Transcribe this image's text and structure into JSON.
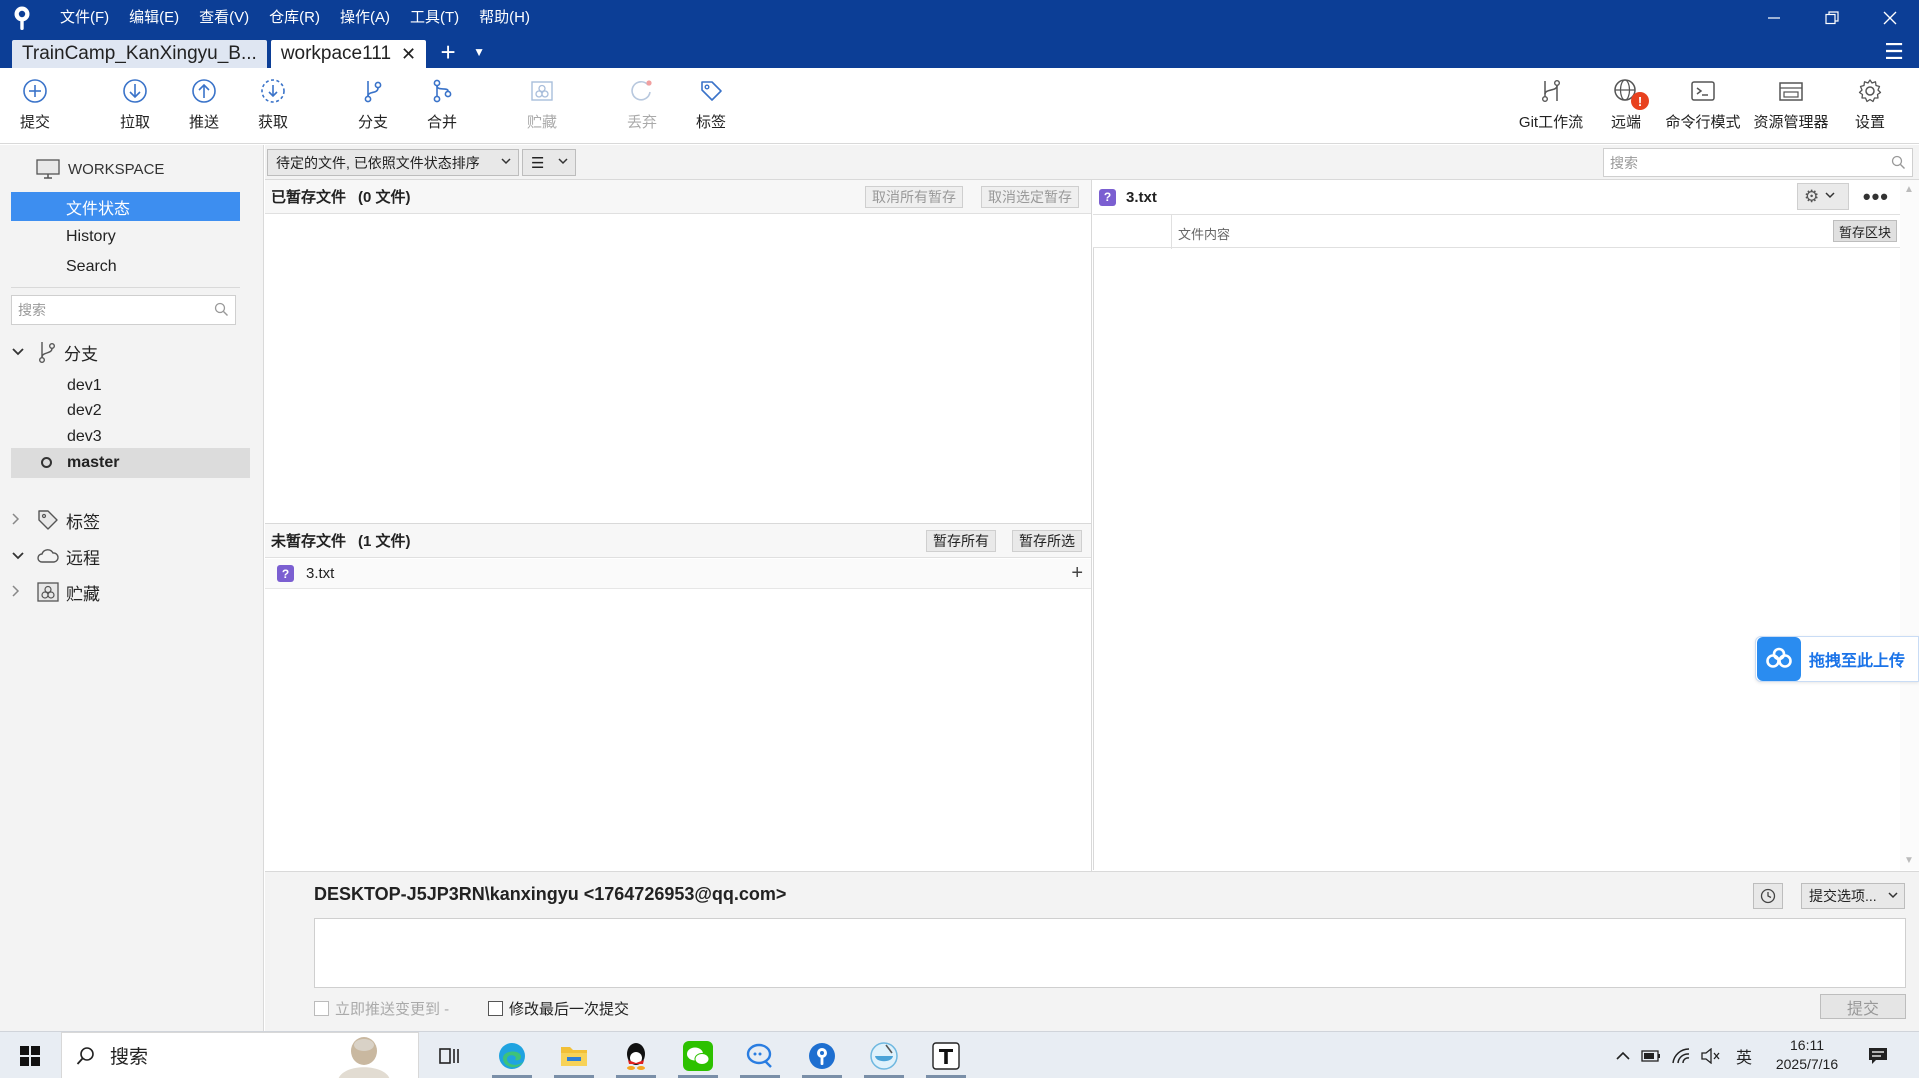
{
  "titlebar": {
    "menus": [
      "文件(F)",
      "编辑(E)",
      "查看(V)",
      "仓库(R)",
      "操作(A)",
      "工具(T)",
      "帮助(H)"
    ]
  },
  "tabs": [
    {
      "label": "TrainCamp_KanXingyu_B...",
      "active": false
    },
    {
      "label": "workpace111",
      "active": true
    }
  ],
  "toolbar": {
    "left": [
      {
        "label": "提交",
        "icon": "commit-plus-icon",
        "enabled": true
      },
      {
        "label": "拉取",
        "icon": "pull-arrow-down-icon",
        "enabled": true
      },
      {
        "label": "推送",
        "icon": "push-arrow-up-icon",
        "enabled": true
      },
      {
        "label": "获取",
        "icon": "fetch-icon",
        "enabled": true
      },
      {
        "label": "分支",
        "icon": "branch-icon",
        "enabled": true
      },
      {
        "label": "合并",
        "icon": "merge-icon",
        "enabled": true
      },
      {
        "label": "贮藏",
        "icon": "stash-icon",
        "enabled": false
      },
      {
        "label": "丢弃",
        "icon": "discard-icon",
        "enabled": false
      },
      {
        "label": "标签",
        "icon": "tag-icon",
        "enabled": true
      }
    ],
    "right": [
      {
        "label": "Git工作流",
        "icon": "git-flow-icon"
      },
      {
        "label": "远端",
        "icon": "remote-globe-icon"
      },
      {
        "label": "命令行模式",
        "icon": "terminal-icon"
      },
      {
        "label": "资源管理器",
        "icon": "explorer-icon"
      },
      {
        "label": "设置",
        "icon": "gear-icon"
      }
    ]
  },
  "sidebar": {
    "workspace_label": "WORKSPACE",
    "nav": [
      {
        "label": "文件状态",
        "selected": true
      },
      {
        "label": "History",
        "selected": false
      },
      {
        "label": "Search",
        "selected": false
      }
    ],
    "search_placeholder": "搜索",
    "groups": {
      "branches": "分支",
      "tags": "标签",
      "remotes": "远程",
      "stashes": "贮藏"
    },
    "branches": [
      "dev1",
      "dev2",
      "dev3",
      "master"
    ],
    "current_branch": "master"
  },
  "filter": {
    "sort_label": "待定的文件, 已依照文件状态排序",
    "view_icon": "list-view-icon",
    "search_placeholder": "搜索"
  },
  "staged": {
    "title": "已暂存文件",
    "count": "(0 文件)",
    "unstage_all": "取消所有暂存",
    "unstage_selected": "取消选定暂存"
  },
  "unstaged": {
    "title": "未暂存文件",
    "count": "(1 文件)",
    "stage_all": "暂存所有",
    "stage_selected": "暂存所选",
    "files": [
      {
        "name": "3.txt",
        "status": "untracked"
      }
    ]
  },
  "diff": {
    "file": "3.txt",
    "column_label": "文件内容",
    "stage_hunk": "暂存区块"
  },
  "upload": {
    "label": "拖拽至此上传"
  },
  "commit": {
    "author": "DESKTOP-J5JP3RN\\kanxingyu <1764726953@qq.com>",
    "options": "提交选项...",
    "push_immediately": "立即推送变更到 -",
    "amend": "修改最后一次提交",
    "commit_button": "提交"
  },
  "taskbar": {
    "search": "搜索",
    "ime": "英",
    "time": "16:11",
    "date": "2025/7/16"
  },
  "colors": {
    "titlebar": "#0c3e96",
    "selection": "#3d8ef0",
    "untracked": "#7b5fd1",
    "remote_error": "#e8411e"
  }
}
